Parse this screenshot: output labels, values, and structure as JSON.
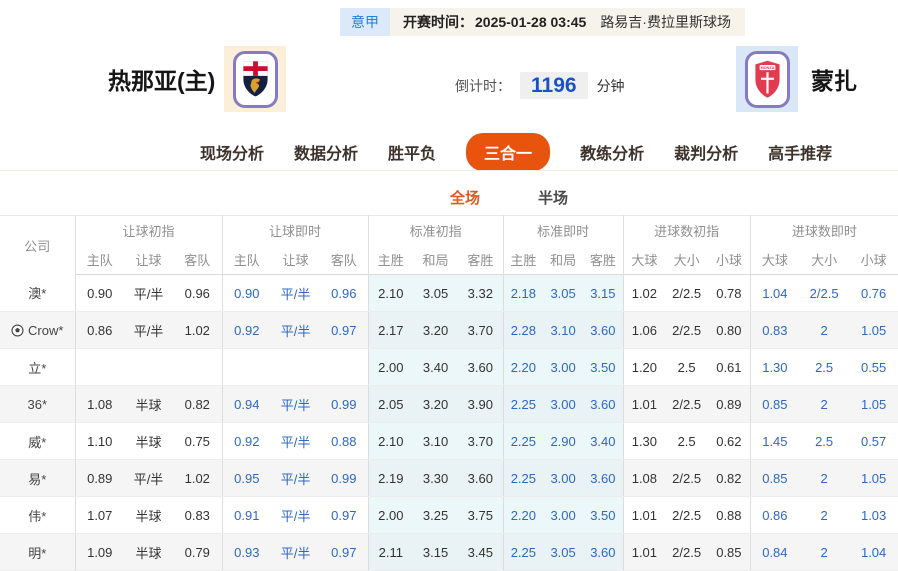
{
  "match_header": {
    "league_badge": "意甲",
    "kickoff_label": "开赛时间：",
    "kickoff_time": "2025-01-28 03:45",
    "venue": "路易吉·费拉里斯球场"
  },
  "teams": {
    "home": {
      "name": "热那亚(主)",
      "crest": "genoa-crest"
    },
    "away": {
      "name": "蒙扎",
      "crest": "monza-crest"
    },
    "countdown": {
      "label": "倒计时：",
      "value": "1196",
      "unit": "分钟"
    }
  },
  "nav_tabs": [
    {
      "id": "live-analysis",
      "label": "现场分析",
      "active": false
    },
    {
      "id": "data-analysis",
      "label": "数据分析",
      "active": false
    },
    {
      "id": "win-draw-lose",
      "label": "胜平负",
      "active": false
    },
    {
      "id": "three-in-one",
      "label": "三合一",
      "active": true
    },
    {
      "id": "coach-analysis",
      "label": "教练分析",
      "active": false
    },
    {
      "id": "referee-analysis",
      "label": "裁判分析",
      "active": false
    },
    {
      "id": "expert-picks",
      "label": "高手推荐",
      "active": false
    }
  ],
  "sub_tabs": [
    {
      "id": "full-match",
      "label": "全场",
      "active": true
    },
    {
      "id": "half-match",
      "label": "半场",
      "active": false
    }
  ],
  "odds_table": {
    "company_header": "公司",
    "groups": [
      {
        "id": "handicap-initial",
        "label": "让球初指",
        "cols": [
          "主队",
          "让球",
          "客队"
        ],
        "type": "init",
        "tint": false
      },
      {
        "id": "handicap-live",
        "label": "让球即时",
        "cols": [
          "主队",
          "让球",
          "客队"
        ],
        "type": "live",
        "tint": false
      },
      {
        "id": "standard-initial",
        "label": "标准初指",
        "cols": [
          "主胜",
          "和局",
          "客胜"
        ],
        "type": "init",
        "tint": true
      },
      {
        "id": "standard-live",
        "label": "标准即时",
        "cols": [
          "主胜",
          "和局",
          "客胜"
        ],
        "type": "live",
        "tint": true
      },
      {
        "id": "goals-initial",
        "label": "进球数初指",
        "cols": [
          "大球",
          "大小",
          "小球"
        ],
        "type": "init",
        "tint": false
      },
      {
        "id": "goals-live",
        "label": "进球数即时",
        "cols": [
          "大球",
          "大小",
          "小球"
        ],
        "type": "live",
        "tint": false
      }
    ],
    "rows": [
      {
        "company": "澳*",
        "icon": false,
        "values": [
          "0.90",
          "平/半",
          "0.96",
          "0.90",
          "平/半",
          "0.96",
          "2.10",
          "3.05",
          "3.32",
          "2.18",
          "3.05",
          "3.15",
          "1.02",
          "2/2.5",
          "0.78",
          "1.04",
          "2/2.5",
          "0.76"
        ]
      },
      {
        "company": "Crow*",
        "icon": true,
        "values": [
          "0.86",
          "平/半",
          "1.02",
          "0.92",
          "平/半",
          "0.97",
          "2.17",
          "3.20",
          "3.70",
          "2.28",
          "3.10",
          "3.60",
          "1.06",
          "2/2.5",
          "0.80",
          "0.83",
          "2",
          "1.05"
        ]
      },
      {
        "company": "立*",
        "icon": false,
        "values": [
          "",
          "",
          "",
          "",
          "",
          "",
          "2.00",
          "3.40",
          "3.60",
          "2.20",
          "3.00",
          "3.50",
          "1.20",
          "2.5",
          "0.61",
          "1.30",
          "2.5",
          "0.55"
        ]
      },
      {
        "company": "36*",
        "icon": false,
        "values": [
          "1.08",
          "半球",
          "0.82",
          "0.94",
          "平/半",
          "0.99",
          "2.05",
          "3.20",
          "3.90",
          "2.25",
          "3.00",
          "3.60",
          "1.01",
          "2/2.5",
          "0.89",
          "0.85",
          "2",
          "1.05"
        ]
      },
      {
        "company": "威*",
        "icon": false,
        "values": [
          "1.10",
          "半球",
          "0.75",
          "0.92",
          "平/半",
          "0.88",
          "2.10",
          "3.10",
          "3.70",
          "2.25",
          "2.90",
          "3.40",
          "1.30",
          "2.5",
          "0.62",
          "1.45",
          "2.5",
          "0.57"
        ]
      },
      {
        "company": "易*",
        "icon": false,
        "values": [
          "0.89",
          "平/半",
          "1.02",
          "0.95",
          "平/半",
          "0.99",
          "2.19",
          "3.30",
          "3.60",
          "2.25",
          "3.00",
          "3.60",
          "1.08",
          "2/2.5",
          "0.82",
          "0.85",
          "2",
          "1.05"
        ]
      },
      {
        "company": "伟*",
        "icon": false,
        "values": [
          "1.07",
          "半球",
          "0.83",
          "0.91",
          "平/半",
          "0.97",
          "2.00",
          "3.25",
          "3.75",
          "2.20",
          "3.00",
          "3.50",
          "1.01",
          "2/2.5",
          "0.88",
          "0.86",
          "2",
          "1.03"
        ]
      },
      {
        "company": "明*",
        "icon": false,
        "values": [
          "1.09",
          "半球",
          "0.79",
          "0.93",
          "平/半",
          "0.97",
          "2.11",
          "3.15",
          "3.45",
          "2.25",
          "3.05",
          "3.60",
          "1.01",
          "2/2.5",
          "0.85",
          "0.84",
          "2",
          "1.04"
        ]
      }
    ]
  },
  "colors": {
    "accent_orange": "#e8530e",
    "subtab_active": "#df5a1f",
    "live_blue": "#2d68c6",
    "init_text": "#333333",
    "header_text": "#8f8f8f",
    "countdown_blue": "#1a50c8",
    "badge_blue_bg": "#dbe9f8",
    "badge_blue_text": "#2f80d0",
    "infobar_bg": "#f6f3ea",
    "tint_bg": "#ecf7f9",
    "row_alt_bg": "#f5f5f5"
  }
}
